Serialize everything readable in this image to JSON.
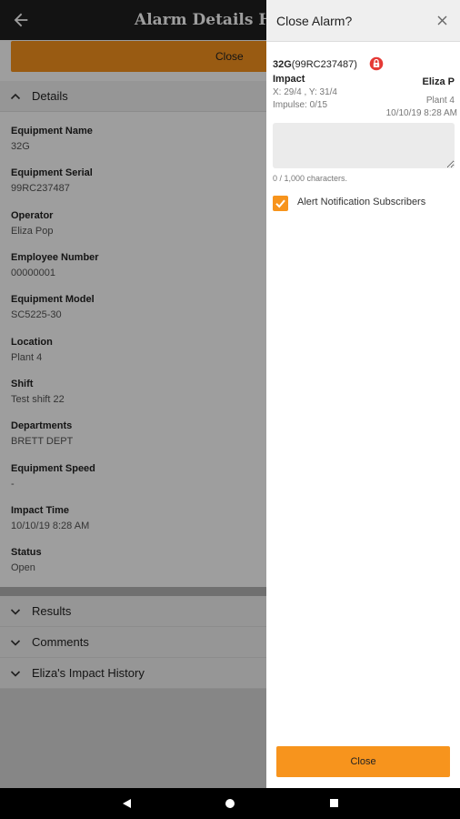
{
  "app": {
    "title": "Alarm Details High",
    "close_label": "Close",
    "details_section": "Details",
    "fields": [
      {
        "label": "Equipment Name",
        "value": "32G"
      },
      {
        "label": "Equipment Serial",
        "value": "99RC237487"
      },
      {
        "label": "Operator",
        "value": "Eliza Pop"
      },
      {
        "label": "Employee Number",
        "value": "00000001"
      },
      {
        "label": "Equipment Model",
        "value": "SC5225-30"
      },
      {
        "label": "Location",
        "value": "Plant 4"
      },
      {
        "label": "Shift",
        "value": "Test shift 22"
      },
      {
        "label": "Departments",
        "value": "BRETT DEPT"
      },
      {
        "label": "Equipment Speed",
        "value": "-"
      },
      {
        "label": "Impact Time",
        "value": "10/10/19 8:28 AM"
      },
      {
        "label": "Status",
        "value": "Open"
      }
    ],
    "collapsed_sections": [
      "Results",
      "Comments",
      "Eliza's Impact History"
    ]
  },
  "dialog": {
    "title": "Close Alarm?",
    "equipment_name": "32G",
    "equipment_serial": "(99RC237487)",
    "event_type": "Impact",
    "operator": "Eliza P",
    "coordinates": "X: 29/4 , Y: 31/4",
    "location": "Plant 4",
    "impulse": "Impulse: 0/15",
    "datetime": "10/10/19 8:28 AM",
    "comment_value": "",
    "char_count": "0 / 1,000 characters.",
    "notify_label": "Alert Notification Subscribers",
    "notify_checked": true,
    "close_button": "Close"
  },
  "colors": {
    "accent": "#f7941d",
    "topbar": "#1f1f1f",
    "lock": "#e53935"
  },
  "icons": [
    "back-arrow-icon",
    "chevron-up-icon",
    "chevron-down-icon",
    "close-icon",
    "lock-icon",
    "checkmark-icon",
    "nav-back-icon",
    "nav-home-icon",
    "nav-recents-icon"
  ]
}
